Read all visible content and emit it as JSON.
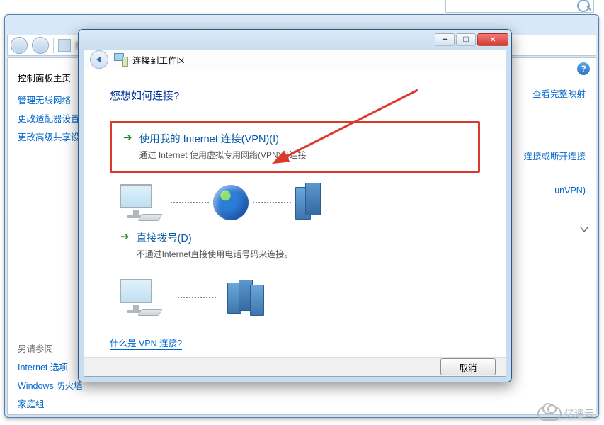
{
  "parent": {
    "title": "控制面板主页",
    "left_links": [
      "管理无线网络",
      "更改适配器设置",
      "更改高级共享设置"
    ],
    "see_also_label": "另请参阅",
    "see_also": [
      "Internet 选项",
      "Windows 防火墙",
      "家庭组"
    ],
    "right_links": {
      "map": "查看完整映射",
      "connect": "连接或断开连接",
      "vpn_item": "unVPN)"
    }
  },
  "dialog": {
    "title": "连接到工作区",
    "question": "您想如何连接?",
    "option1": {
      "title": "使用我的 Internet 连接(VPN)(I)",
      "subtitle": "通过 Internet 使用虚拟专用网络(VPN)来连接"
    },
    "option2": {
      "title": "直接拨号(D)",
      "subtitle": "不通过Internet直接使用电话号码来连接。"
    },
    "help_link": "什么是 VPN 连接?",
    "cancel": "取消"
  },
  "watermark": "亿速云"
}
